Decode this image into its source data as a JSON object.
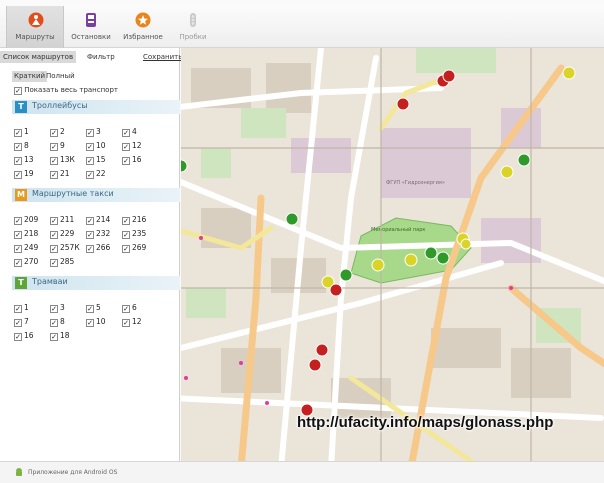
{
  "tabs": [
    {
      "label": "Маршруты",
      "icon": "person-icon",
      "active": true
    },
    {
      "label": "Остановки",
      "icon": "bus-stop-icon"
    },
    {
      "label": "Избранное",
      "icon": "star-icon"
    },
    {
      "label": "Пробки",
      "icon": "traffic-light-icon"
    }
  ],
  "panel": {
    "subtabs": {
      "routes_list": "Список маршрутов",
      "filter": "Фильтр",
      "save": "Сохранить"
    },
    "views": {
      "short": "Краткий",
      "full": "Полный"
    },
    "show_all": "Показать весь транспорт",
    "categories": {
      "trolleybus": {
        "badge": "Т",
        "title": "Троллейбусы",
        "routes": [
          "1",
          "2",
          "3",
          "4",
          "8",
          "9",
          "10",
          "12",
          "13",
          "13К",
          "15",
          "16",
          "19",
          "21",
          "22"
        ]
      },
      "minibus": {
        "badge": "М",
        "title": "Маршрутные такси",
        "routes": [
          "209",
          "211",
          "214",
          "216",
          "218",
          "229",
          "232",
          "235",
          "249",
          "257К",
          "266",
          "269",
          "270",
          "285"
        ]
      },
      "tram": {
        "badge": "Т",
        "title": "Трамваи",
        "routes": [
          "1",
          "3",
          "5",
          "6",
          "7",
          "8",
          "10",
          "12",
          "16",
          "18"
        ]
      }
    }
  },
  "map": {
    "url": "http://ufacity.info/maps/glonass.php",
    "labels": {
      "park": "Мемориальный парк",
      "district": "ФГУП «Гидроэнергия»"
    }
  },
  "footer": {
    "label": "Приложение для Android OS"
  },
  "colors": {
    "trolleybus": "#2a8fc5",
    "minibus": "#e89a1e",
    "tram": "#5ea53a",
    "accent": "#e24e1b"
  }
}
